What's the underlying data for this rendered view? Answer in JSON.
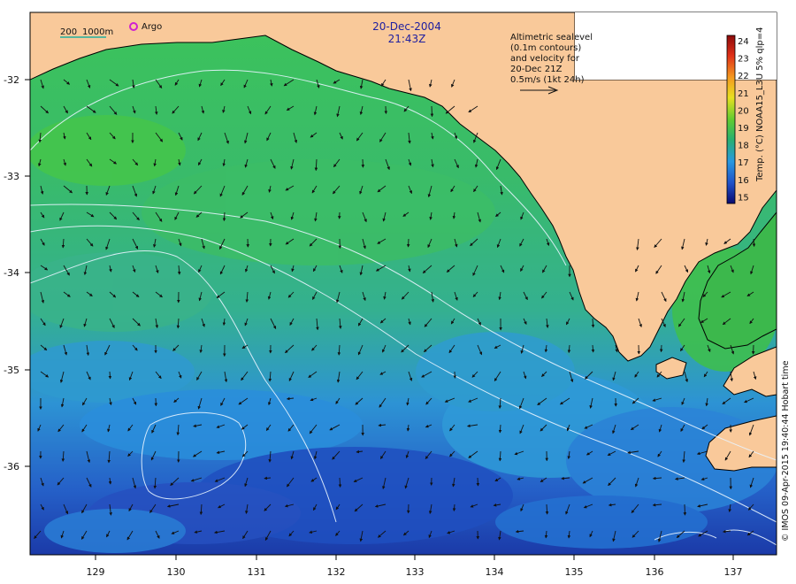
{
  "header": {
    "date": "20-Dec-2004",
    "time": "21:43Z"
  },
  "scale_bar": {
    "label_short": "200",
    "label_long": "1000m"
  },
  "legend_marker": {
    "label": "Argo"
  },
  "annotation": {
    "lines": [
      "Altimetric sealevel",
      "(0.1m contours)",
      "and velocity for",
      "20-Dec 21Z",
      "0.5m/s (1kt 24h)"
    ]
  },
  "colorbar": {
    "title": "Temp. (°C) NOAA15_L3U 5% qlp=4",
    "ticks": [
      "24",
      "23",
      "22",
      "21",
      "20",
      "19",
      "18",
      "17",
      "16",
      "15"
    ]
  },
  "axes": {
    "y_ticks": [
      "-32",
      "-33",
      "-34",
      "-35",
      "-36"
    ],
    "x_ticks": [
      "129",
      "130",
      "131",
      "132",
      "133",
      "134",
      "135",
      "136",
      "137"
    ]
  },
  "credit": "© IMOS 09-Apr-2015 19:40:44 Hobart time",
  "colors": {
    "land": "#f9c99a",
    "ocean_green": "#3fbe55",
    "ocean_teal": "#36b49a",
    "ocean_blue": "#2a8fe0",
    "ocean_deep": "#1b3fb0",
    "contour": "#e8f4ff",
    "annotation_text": "#2020a0",
    "argo_marker": "#d020d0",
    "scale_bar": "#20b0a0"
  }
}
